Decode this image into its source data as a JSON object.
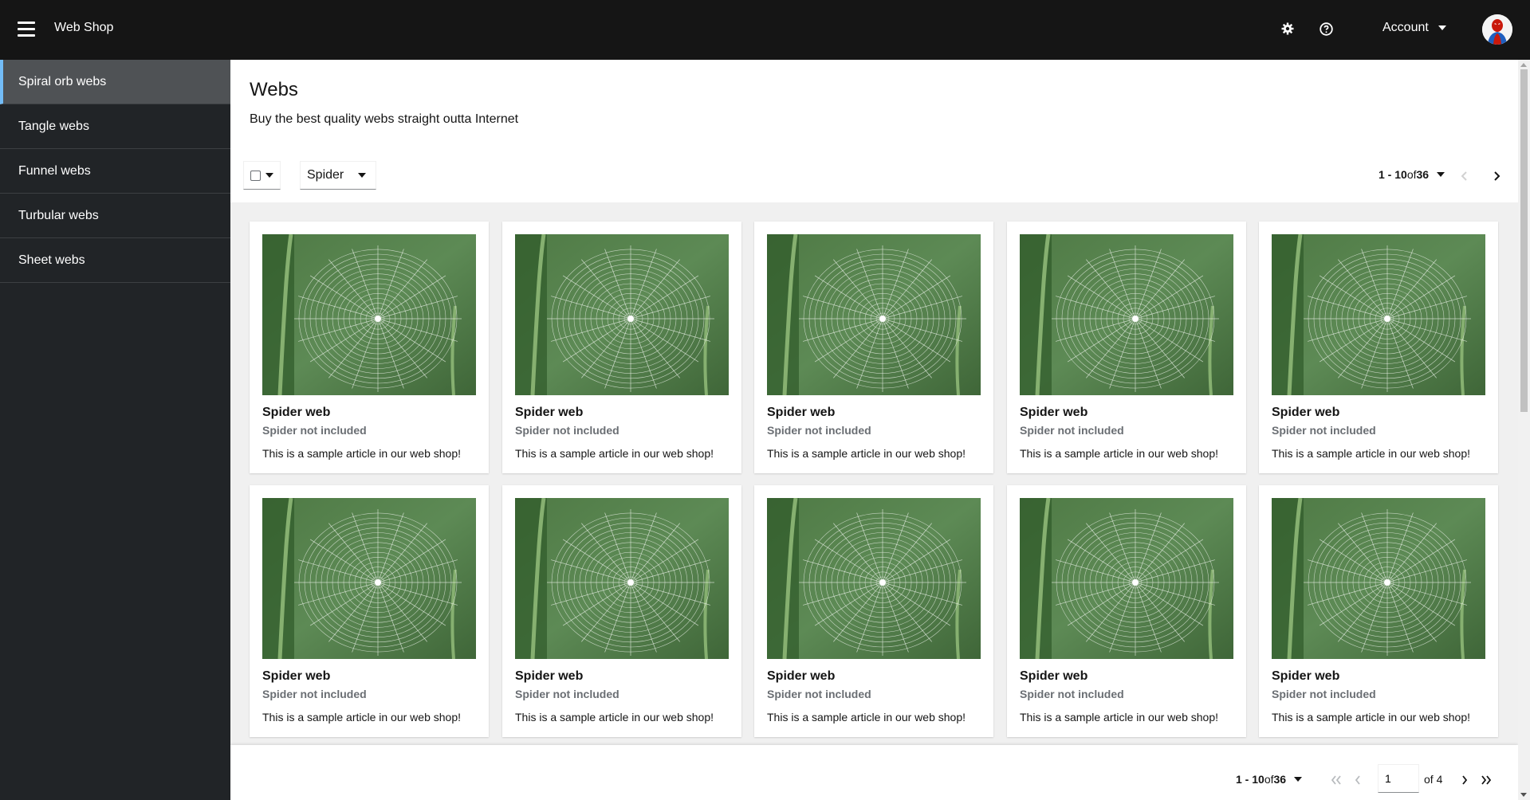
{
  "header": {
    "brand": "Web Shop",
    "account_label": "Account",
    "icons": [
      "hamburger-icon",
      "gear-icon",
      "help-icon",
      "caret-down-icon",
      "avatar"
    ]
  },
  "sidebar": {
    "items": [
      {
        "label": "Spiral orb webs",
        "active": true
      },
      {
        "label": "Tangle webs"
      },
      {
        "label": "Funnel webs"
      },
      {
        "label": "Turbular webs"
      },
      {
        "label": "Sheet webs"
      }
    ]
  },
  "page": {
    "title": "Webs",
    "description": "Buy the best quality webs straight outta Internet"
  },
  "toolbar": {
    "filter_value": "Spider",
    "pagination": {
      "range": "1 - 10",
      "of": "of",
      "total": "36"
    }
  },
  "cards": [
    {
      "title": "Spider web",
      "subtitle": "Spider not included",
      "body": "This is a sample article in our web shop!"
    },
    {
      "title": "Spider web",
      "subtitle": "Spider not included",
      "body": "This is a sample article in our web shop!"
    },
    {
      "title": "Spider web",
      "subtitle": "Spider not included",
      "body": "This is a sample article in our web shop!"
    },
    {
      "title": "Spider web",
      "subtitle": "Spider not included",
      "body": "This is a sample article in our web shop!"
    },
    {
      "title": "Spider web",
      "subtitle": "Spider not included",
      "body": "This is a sample article in our web shop!"
    },
    {
      "title": "Spider web",
      "subtitle": "Spider not included",
      "body": "This is a sample article in our web shop!"
    },
    {
      "title": "Spider web",
      "subtitle": "Spider not included",
      "body": "This is a sample article in our web shop!"
    },
    {
      "title": "Spider web",
      "subtitle": "Spider not included",
      "body": "This is a sample article in our web shop!"
    },
    {
      "title": "Spider web",
      "subtitle": "Spider not included",
      "body": "This is a sample article in our web shop!"
    },
    {
      "title": "Spider web",
      "subtitle": "Spider not included",
      "body": "This is a sample article in our web shop!"
    }
  ],
  "bottom_pagination": {
    "range": "1 - 10",
    "of": "of",
    "total": "36",
    "current_page": "1",
    "of_pages": "of 4"
  },
  "colors": {
    "header_bg": "#151515",
    "sidebar_bg": "#212427",
    "active_accent": "#73bcf7"
  }
}
